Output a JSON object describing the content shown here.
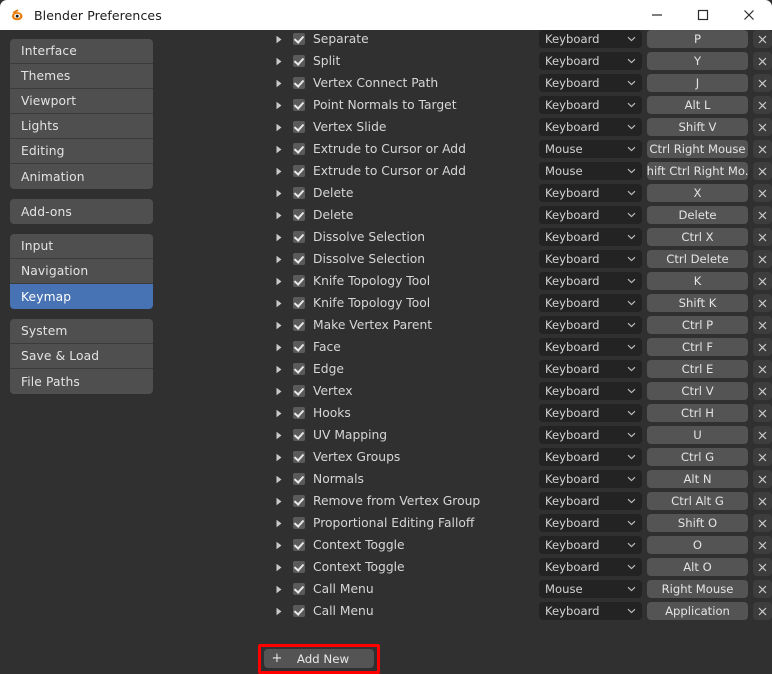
{
  "window": {
    "title": "Blender Preferences",
    "icon": "blender-logo-icon",
    "minimize_label": "Minimize",
    "maximize_label": "Maximize",
    "close_label": "Close",
    "accent_color": "#4772b3",
    "highlight_color": "#ff0000",
    "titlebar_bg": "#ffffff",
    "body_bg": "#303030"
  },
  "sidebar": {
    "groups": [
      {
        "items": [
          {
            "label": "Interface",
            "active": false
          },
          {
            "label": "Themes",
            "active": false
          },
          {
            "label": "Viewport",
            "active": false
          },
          {
            "label": "Lights",
            "active": false
          },
          {
            "label": "Editing",
            "active": false
          },
          {
            "label": "Animation",
            "active": false
          }
        ]
      },
      {
        "items": [
          {
            "label": "Add-ons",
            "active": false
          }
        ]
      },
      {
        "items": [
          {
            "label": "Input",
            "active": false
          },
          {
            "label": "Navigation",
            "active": false
          },
          {
            "label": "Keymap",
            "active": true
          }
        ]
      },
      {
        "items": [
          {
            "label": "System",
            "active": false
          },
          {
            "label": "Save & Load",
            "active": false
          },
          {
            "label": "File Paths",
            "active": false
          }
        ]
      }
    ]
  },
  "keymap": {
    "columns": [
      "name",
      "map_type",
      "key_binding",
      "remove"
    ],
    "rows": [
      {
        "label": "Separate",
        "type": "Keyboard",
        "key": "P",
        "checked": true,
        "clipped": true
      },
      {
        "label": "Split",
        "type": "Keyboard",
        "key": "Y",
        "checked": true
      },
      {
        "label": "Vertex Connect Path",
        "type": "Keyboard",
        "key": "J",
        "checked": true
      },
      {
        "label": "Point Normals to Target",
        "type": "Keyboard",
        "key": "Alt L",
        "checked": true
      },
      {
        "label": "Vertex Slide",
        "type": "Keyboard",
        "key": "Shift V",
        "checked": true
      },
      {
        "label": "Extrude to Cursor or Add",
        "type": "Mouse",
        "key": "Ctrl Right Mouse",
        "checked": true
      },
      {
        "label": "Extrude to Cursor or Add",
        "type": "Mouse",
        "key": "Shift Ctrl Right Mo...",
        "checked": true
      },
      {
        "label": "Delete",
        "type": "Keyboard",
        "key": "X",
        "checked": true
      },
      {
        "label": "Delete",
        "type": "Keyboard",
        "key": "Delete",
        "checked": true
      },
      {
        "label": "Dissolve Selection",
        "type": "Keyboard",
        "key": "Ctrl X",
        "checked": true
      },
      {
        "label": "Dissolve Selection",
        "type": "Keyboard",
        "key": "Ctrl Delete",
        "checked": true
      },
      {
        "label": "Knife Topology Tool",
        "type": "Keyboard",
        "key": "K",
        "checked": true
      },
      {
        "label": "Knife Topology Tool",
        "type": "Keyboard",
        "key": "Shift K",
        "checked": true
      },
      {
        "label": "Make Vertex Parent",
        "type": "Keyboard",
        "key": "Ctrl P",
        "checked": true
      },
      {
        "label": "Face",
        "type": "Keyboard",
        "key": "Ctrl F",
        "checked": true
      },
      {
        "label": "Edge",
        "type": "Keyboard",
        "key": "Ctrl E",
        "checked": true
      },
      {
        "label": "Vertex",
        "type": "Keyboard",
        "key": "Ctrl V",
        "checked": true
      },
      {
        "label": "Hooks",
        "type": "Keyboard",
        "key": "Ctrl H",
        "checked": true
      },
      {
        "label": "UV Mapping",
        "type": "Keyboard",
        "key": "U",
        "checked": true
      },
      {
        "label": "Vertex Groups",
        "type": "Keyboard",
        "key": "Ctrl G",
        "checked": true
      },
      {
        "label": "Normals",
        "type": "Keyboard",
        "key": "Alt N",
        "checked": true
      },
      {
        "label": "Remove from Vertex Group",
        "type": "Keyboard",
        "key": "Ctrl Alt G",
        "checked": true
      },
      {
        "label": "Proportional Editing Falloff",
        "type": "Keyboard",
        "key": "Shift O",
        "checked": true
      },
      {
        "label": "Context Toggle",
        "type": "Keyboard",
        "key": "O",
        "checked": true
      },
      {
        "label": "Context Toggle",
        "type": "Keyboard",
        "key": "Alt O",
        "checked": true
      },
      {
        "label": "Call Menu",
        "type": "Mouse",
        "key": "Right Mouse",
        "checked": true
      },
      {
        "label": "Call Menu",
        "type": "Keyboard",
        "key": "Application",
        "checked": true
      }
    ]
  },
  "add_new": {
    "label": "Add New",
    "plus": "+"
  }
}
